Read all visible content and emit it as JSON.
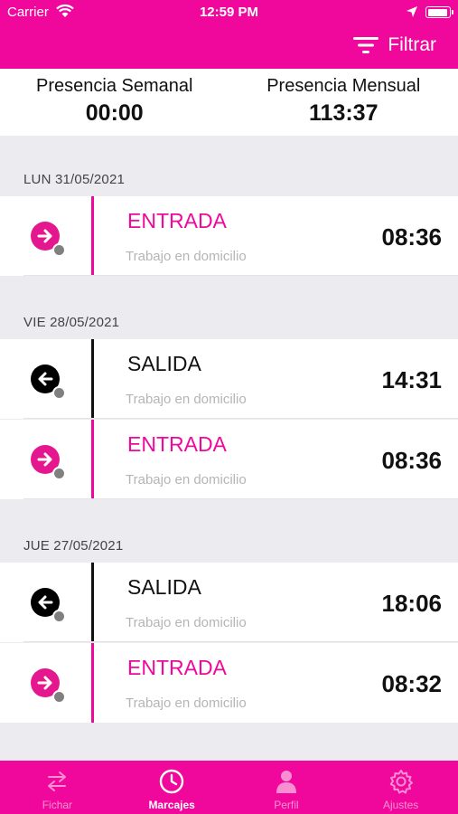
{
  "status": {
    "carrier": "Carrier",
    "time": "12:59 PM"
  },
  "nav": {
    "filter_label": "Filtrar"
  },
  "summary": {
    "weekly_label": "Presencia Semanal",
    "weekly_value": "00:00",
    "monthly_label": "Presencia Mensual",
    "monthly_value": "113:37"
  },
  "days": [
    {
      "header": "LUN 31/05/2021",
      "entries": [
        {
          "type": "ENTRADA",
          "place": "Trabajo en domicilio",
          "time": "08:36",
          "icon": "arrow-right-icon"
        }
      ]
    },
    {
      "header": "VIE 28/05/2021",
      "entries": [
        {
          "type": "SALIDA",
          "place": "Trabajo en domicilio",
          "time": "14:31",
          "icon": "arrow-left-icon"
        },
        {
          "type": "ENTRADA",
          "place": "Trabajo en domicilio",
          "time": "08:36",
          "icon": "arrow-right-icon"
        }
      ]
    },
    {
      "header": "JUE 27/05/2021",
      "entries": [
        {
          "type": "SALIDA",
          "place": "Trabajo en domicilio",
          "time": "18:06",
          "icon": "arrow-left-icon"
        },
        {
          "type": "ENTRADA",
          "place": "Trabajo en domicilio",
          "time": "08:32",
          "icon": "arrow-right-icon"
        }
      ]
    }
  ],
  "tabs": [
    {
      "label": "Fichar",
      "icon": "swap-arrows-icon",
      "active": false
    },
    {
      "label": "Marcajes",
      "icon": "clock-icon",
      "active": true
    },
    {
      "label": "Perfil",
      "icon": "person-icon",
      "active": false
    },
    {
      "label": "Ajustes",
      "icon": "gear-icon",
      "active": false
    }
  ],
  "colors": {
    "brand": "#f0089c",
    "entrada_icon": "#e5178e",
    "salida_icon": "#000000",
    "location_dot": "#808080"
  }
}
